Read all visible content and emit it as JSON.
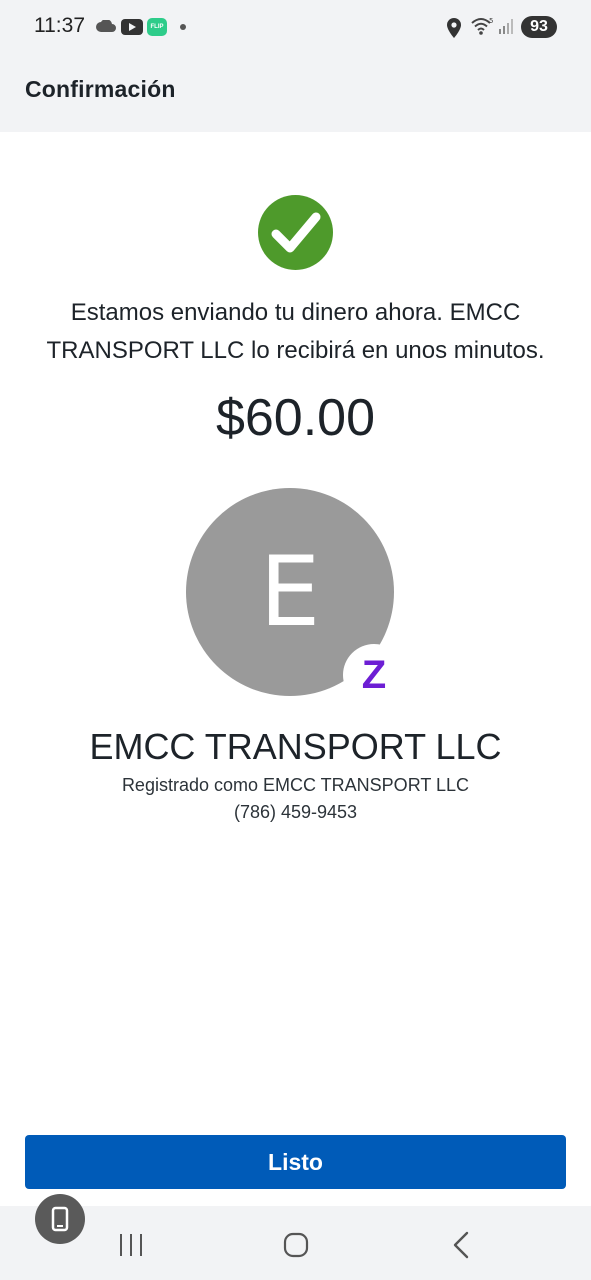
{
  "status_bar": {
    "time": "11:37",
    "flip_label": "FLIP",
    "battery": "93",
    "icons": [
      "cloud-icon",
      "youtube-icon",
      "flip-icon",
      "notification-dot-icon",
      "location-icon",
      "wifi-icon",
      "signal-icon",
      "battery-icon"
    ]
  },
  "header": {
    "title": "Confirmación"
  },
  "confirmation": {
    "status_icon": "check-icon",
    "status_color": "#4e9a2b",
    "message": "Estamos enviando tu dinero ahora. EMCC TRANSPORT LLC lo recibirá en unos minutos.",
    "amount": "$60.00"
  },
  "recipient": {
    "avatar_letter": "E",
    "avatar_color": "#9a9a9a",
    "badge_letter": "Z",
    "badge_color": "#6d1ed4",
    "name": "EMCC TRANSPORT LLC",
    "registered_as": "Registrado como EMCC TRANSPORT LLC",
    "phone": "(786) 459-9453"
  },
  "actions": {
    "done_label": "Listo",
    "accent": "#005bb8"
  },
  "nav_bar": {
    "icons": [
      "recents-icon",
      "home-icon",
      "back-icon"
    ],
    "floating_icon": "phone-icon"
  }
}
